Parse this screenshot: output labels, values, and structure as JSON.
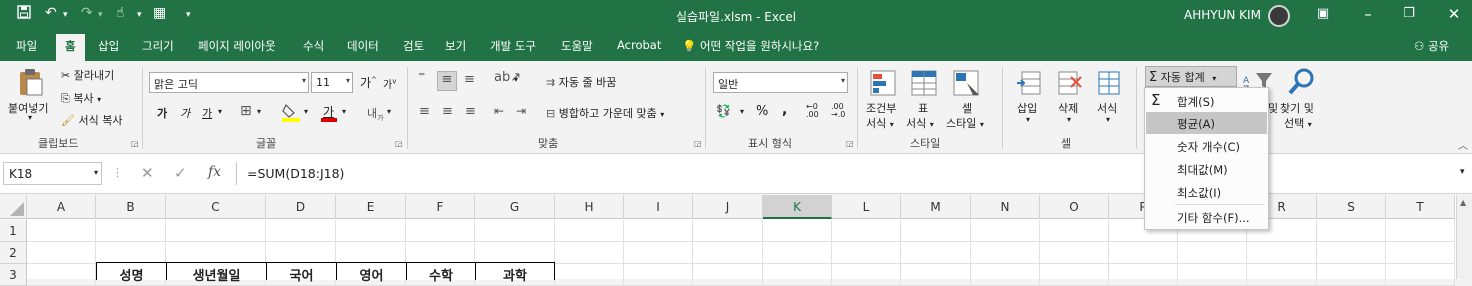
{
  "window": {
    "title": "실습파일.xlsm  -  Excel",
    "user_name": "AHHYUN KIM"
  },
  "tabs": [
    {
      "label": "파일",
      "active": false
    },
    {
      "label": "홈",
      "active": true
    },
    {
      "label": "삽입",
      "active": false
    },
    {
      "label": "그리기",
      "active": false
    },
    {
      "label": "페이지 레이아웃",
      "active": false
    },
    {
      "label": "수식",
      "active": false
    },
    {
      "label": "데이터",
      "active": false
    },
    {
      "label": "검토",
      "active": false
    },
    {
      "label": "보기",
      "active": false
    },
    {
      "label": "개발 도구",
      "active": false
    },
    {
      "label": "도움말",
      "active": false
    },
    {
      "label": "Acrobat",
      "active": false
    }
  ],
  "tell_me": "어떤 작업을 원하시나요?",
  "share": "공유",
  "ribbon": {
    "clipboard": {
      "paste": "붙여넣기",
      "cut": "잘라내기",
      "copy": "복사",
      "format_painter": "서식 복사",
      "label": "클립보드"
    },
    "font": {
      "font_name": "맑은 고딕",
      "font_size": "11",
      "bold": "가",
      "italic": "가",
      "underline": "가",
      "font_color_glyph": "가",
      "grow": "가",
      "shrink": "가",
      "label": "글꼴"
    },
    "alignment": {
      "wrap_text": "자동 줄 바꿈",
      "merge_center": "병합하고 가운데 맞춤",
      "label": "맞춤"
    },
    "number": {
      "format": "일반",
      "percent": "%",
      "comma": ",",
      "label": "표시 형식"
    },
    "styles": {
      "conditional": "조건부",
      "conditional_2": "서식",
      "table": "표",
      "table_2": "서식",
      "cell": "셀",
      "cell_2": "스타일",
      "label": "스타일"
    },
    "cells": {
      "insert": "삽입",
      "delete": "삭제",
      "format": "서식",
      "label": "셀"
    },
    "editing": {
      "autosum": "자동 합계",
      "sort_partial": "및",
      "find": "찾기 및",
      "find_2": "선택"
    }
  },
  "autosum_menu": [
    {
      "label": "합계(S)",
      "highlighted": false
    },
    {
      "label": "평균(A)",
      "highlighted": true
    },
    {
      "label": "숫자 개수(C)",
      "highlighted": false
    },
    {
      "label": "최대값(M)",
      "highlighted": false
    },
    {
      "label": "최소값(I)",
      "highlighted": false
    },
    {
      "label": "기타 함수(F)...",
      "highlighted": false
    }
  ],
  "formula_bar": {
    "name_box": "K18",
    "fx": "fx",
    "formula": "=SUM(D18:J18)"
  },
  "grid": {
    "columns": [
      "A",
      "B",
      "C",
      "D",
      "E",
      "F",
      "G",
      "H",
      "I",
      "J",
      "K",
      "L",
      "M",
      "N",
      "O",
      "P",
      "Q",
      "R",
      "S",
      "T"
    ],
    "selected_column": "K",
    "rows": [
      "1",
      "2",
      "3"
    ],
    "row3_headers": [
      "성명",
      "생년월일",
      "국어",
      "영어",
      "수학",
      "과학"
    ]
  },
  "colors": {
    "accent": "#217346"
  }
}
